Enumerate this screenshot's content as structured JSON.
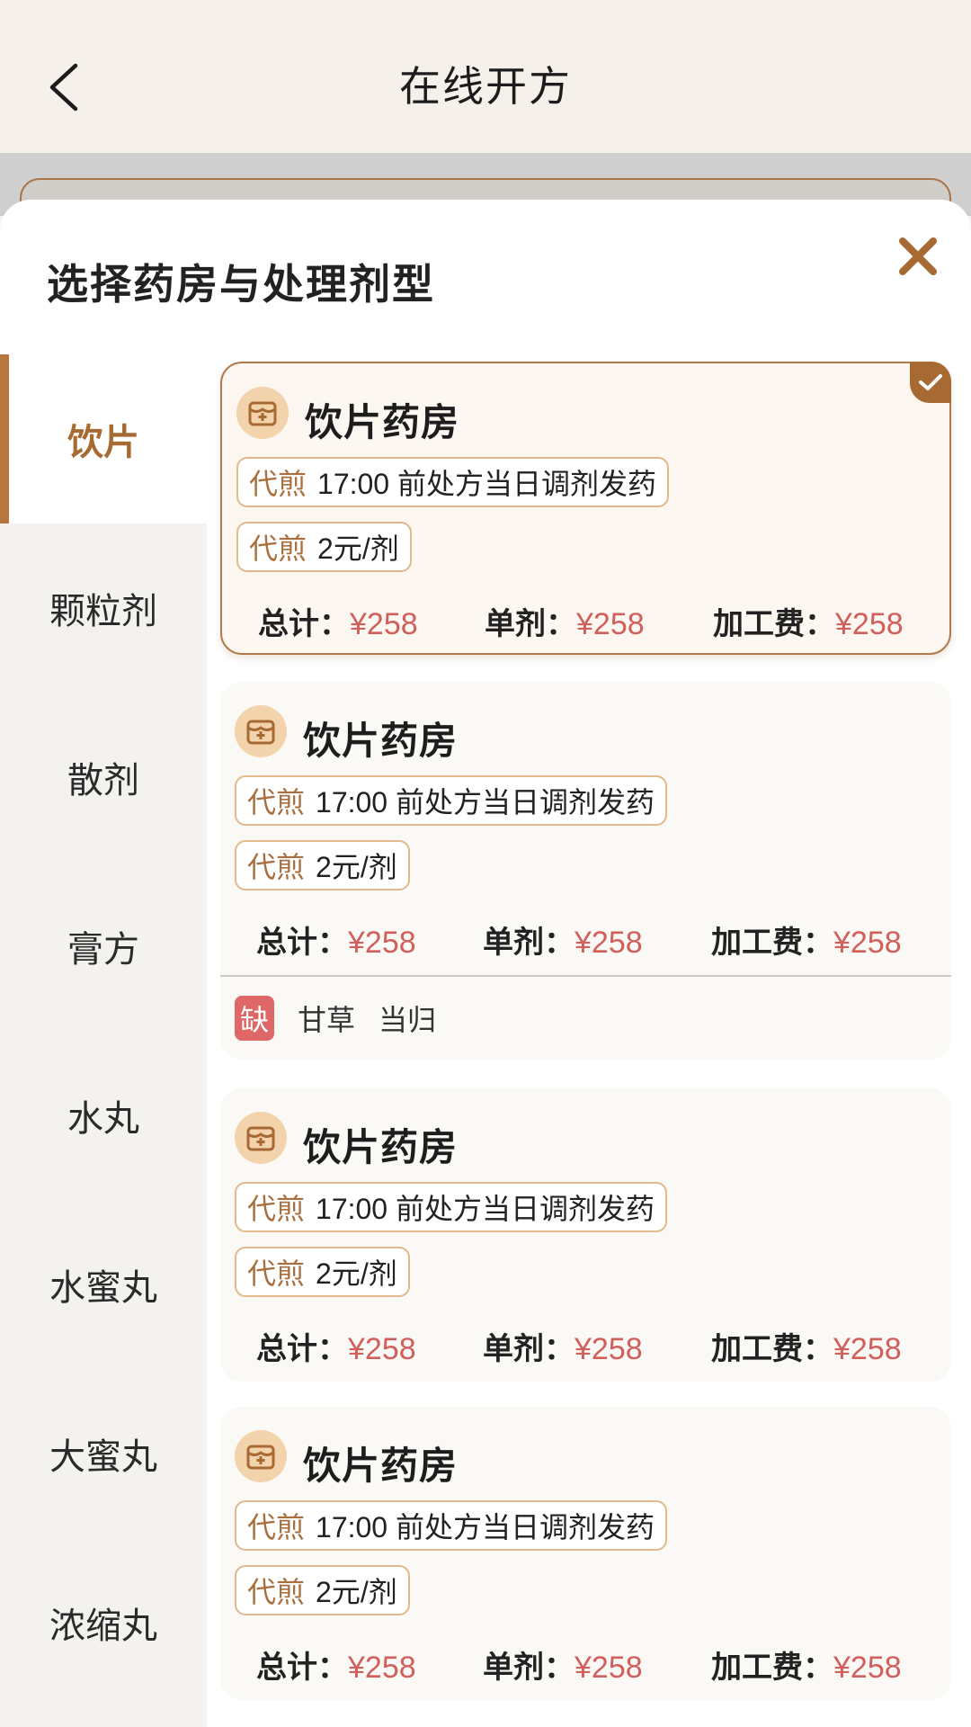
{
  "header": {
    "title": "在线开方"
  },
  "sheet": {
    "title": "选择药房与处理剂型"
  },
  "tabs": [
    {
      "label": "饮片",
      "active": true
    },
    {
      "label": "颗粒剂",
      "active": false
    },
    {
      "label": "散剂",
      "active": false
    },
    {
      "label": "膏方",
      "active": false
    },
    {
      "label": "水丸",
      "active": false
    },
    {
      "label": "水蜜丸",
      "active": false
    },
    {
      "label": "大蜜丸",
      "active": false
    },
    {
      "label": "浓缩丸",
      "active": false
    }
  ],
  "cards": [
    {
      "name": "饮片药房",
      "selected": true,
      "tag1_key": "代煎",
      "tag1_text": "17:00 前处方当日调剂发药",
      "tag2_key": "代煎",
      "tag2_text": "2元/剂",
      "total_label": "总计：",
      "total": "¥258",
      "single_label": "单剂：",
      "single": "¥258",
      "fee_label": "加工费：",
      "fee": "¥258"
    },
    {
      "name": "饮片药房",
      "selected": false,
      "tag1_key": "代煎",
      "tag1_text": "17:00 前处方当日调剂发药",
      "tag2_key": "代煎",
      "tag2_text": "2元/剂",
      "total_label": "总计：",
      "total": "¥258",
      "single_label": "单剂：",
      "single": "¥258",
      "fee_label": "加工费：",
      "fee": "¥258",
      "shortage_badge": "缺",
      "shortage_items": [
        "甘草",
        "当归"
      ]
    },
    {
      "name": "饮片药房",
      "selected": false,
      "tag1_key": "代煎",
      "tag1_text": "17:00 前处方当日调剂发药",
      "tag2_key": "代煎",
      "tag2_text": "2元/剂",
      "total_label": "总计：",
      "total": "¥258",
      "single_label": "单剂：",
      "single": "¥258",
      "fee_label": "加工费：",
      "fee": "¥258"
    },
    {
      "name": "饮片药房",
      "selected": false,
      "tag1_key": "代煎",
      "tag1_text": "17:00 前处方当日调剂发药",
      "tag2_key": "代煎",
      "tag2_text": "2元/剂",
      "total_label": "总计：",
      "total": "¥258",
      "single_label": "单剂：",
      "single": "¥258",
      "fee_label": "加工费：",
      "fee": "¥258"
    }
  ],
  "colors": {
    "accent": "#a86a33",
    "price": "#d15f5b",
    "shortage": "#df6767"
  }
}
